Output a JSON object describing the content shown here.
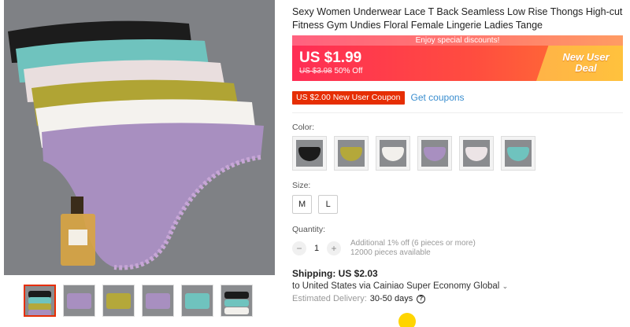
{
  "product": {
    "title": "Sexy Women Underwear Lace T Back Seamless Low Rise Thongs High-cut Fitness Gym Undies Floral Female Lingerie Ladies Tange",
    "discount_banner": "Enjoy special discounts!",
    "price": "US $1.99",
    "old_price": "US $3.98",
    "discount_pct": "50% Off",
    "deal_line1": "New User",
    "deal_line2": "Deal",
    "colors": {
      "brand_red": "#e62e04",
      "banner_start": "#ff2d55",
      "banner_end": "#ff7a30",
      "deal_yellow": "#ffc23d",
      "link_blue": "#3a8ecf"
    }
  },
  "coupon": {
    "tag": "US $2.00 New User Coupon",
    "link": "Get coupons"
  },
  "options": {
    "color_label": "Color:",
    "color_swatches": [
      {
        "name": "black",
        "hex": "#1b1b1b"
      },
      {
        "name": "yellow",
        "hex": "#b4a83a"
      },
      {
        "name": "white",
        "hex": "#f2f0ec"
      },
      {
        "name": "purple",
        "hex": "#a88fc0"
      },
      {
        "name": "pink-white",
        "hex": "#ece4e6"
      },
      {
        "name": "mint",
        "hex": "#6fc3be"
      }
    ],
    "size_label": "Size:",
    "sizes": [
      "M",
      "L"
    ],
    "quantity_label": "Quantity:",
    "quantity": "1",
    "minus": "−",
    "plus": "+",
    "bulk_info": "Additional 1% off (6 pieces or more)",
    "stock_info": "12000 pieces available"
  },
  "shipping": {
    "title": "Shipping: US $2.03",
    "to": "to United States via Cainiao Super Economy Global",
    "chevron": "⌄",
    "delivery_label": "Estimated Delivery:",
    "delivery_days": "30-50 days",
    "help": "?"
  },
  "gallery": {
    "thumbnails": [
      "thumb-1",
      "thumb-2",
      "thumb-3",
      "thumb-4",
      "thumb-5",
      "thumb-6"
    ]
  }
}
